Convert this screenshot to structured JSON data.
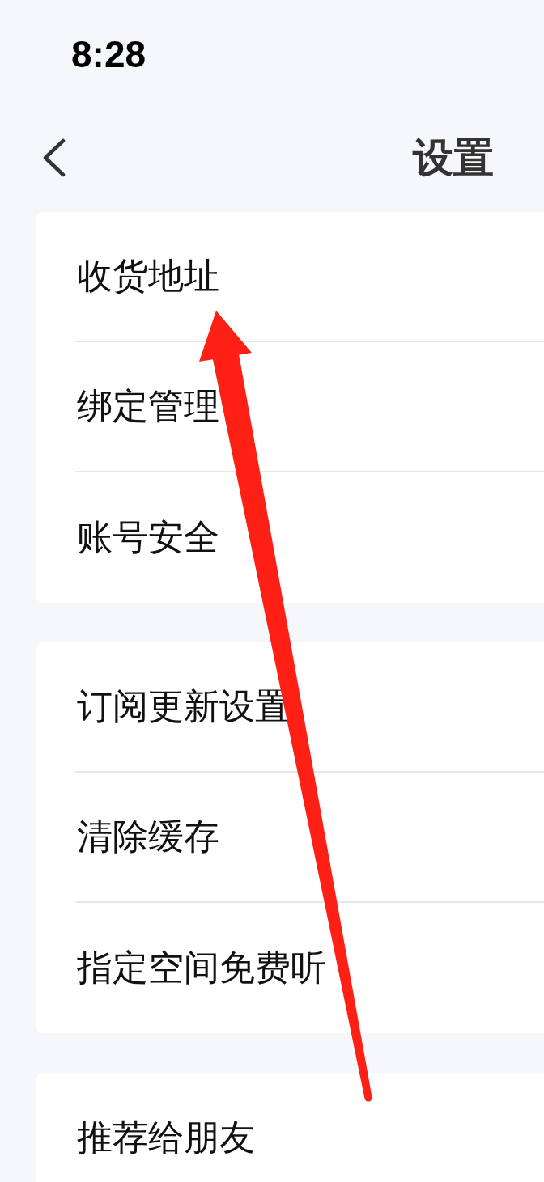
{
  "status_bar": {
    "time": "8:28"
  },
  "nav_bar": {
    "back": {
      "kind": "chevron"
    },
    "title": "设置"
  },
  "groups": [
    {
      "items": [
        {
          "label": "收货地址"
        },
        {
          "label": "绑定管理"
        },
        {
          "label": "账号安全"
        }
      ]
    },
    {
      "items": [
        {
          "label": "订阅更新设置"
        },
        {
          "label": "清除缓存"
        },
        {
          "label": "指定空间免费听"
        }
      ]
    },
    {
      "items": [
        {
          "label": "推荐给朋友"
        }
      ]
    }
  ],
  "annotation": {
    "kind": "arrow"
  }
}
